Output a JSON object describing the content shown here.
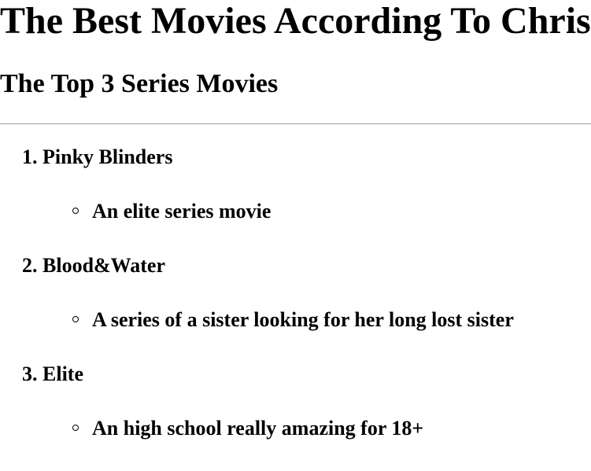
{
  "header": {
    "title": "The Best Movies According To Chris",
    "subtitle": "The Top 3 Series Movies"
  },
  "movies": [
    {
      "number": "1.",
      "title": "Pinky Blinders",
      "description": "An elite series movie"
    },
    {
      "number": "2.",
      "title": "Blood&Water",
      "description": "A series of a sister looking for her long lost sister"
    },
    {
      "number": "3.",
      "title": "Elite",
      "description": "An high school really amazing for 18+"
    }
  ],
  "icons": {
    "bullet": "hollow-circle-bullet-icon"
  }
}
